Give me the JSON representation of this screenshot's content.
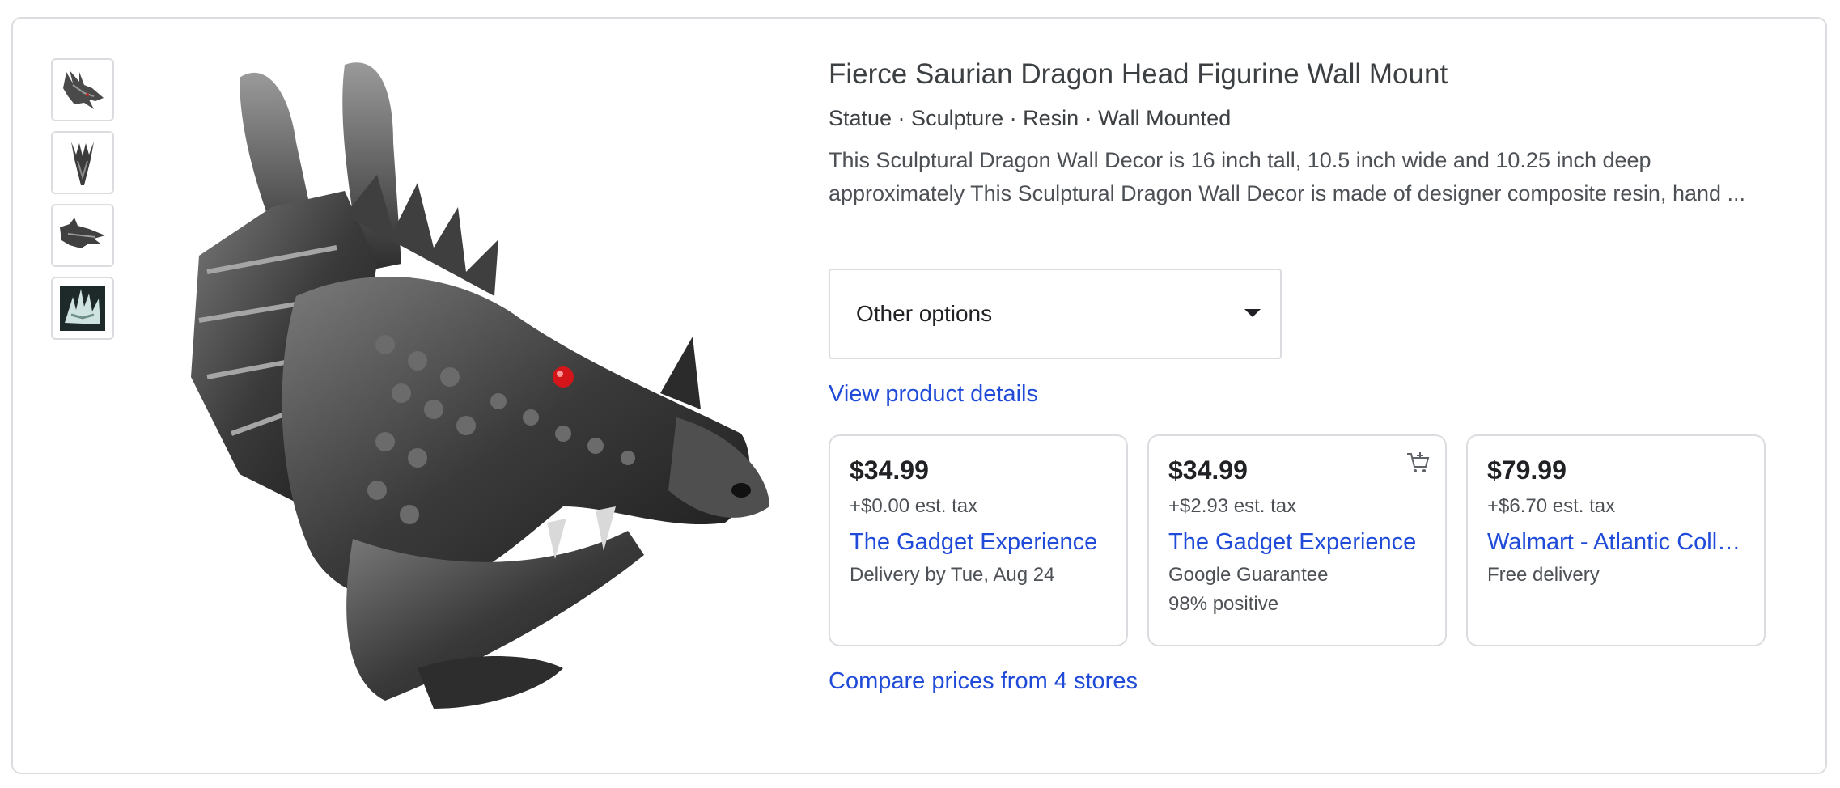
{
  "product": {
    "title": "Fierce Saurian Dragon Head Figurine Wall Mount",
    "subtitle": "Statue · Sculpture · Resin · Wall Mounted",
    "description": "This Sculptural Dragon Wall Decor is 16 inch tall, 10.5 inch wide and 10.25 inch deep approximately This Sculptural Dragon Wall Decor is made of designer composite resin, hand ...",
    "image_alt": "dragon head wall mount statue"
  },
  "thumbnails": [
    {
      "icon": "dragon-head-side-thumb"
    },
    {
      "icon": "dragon-head-front-thumb"
    },
    {
      "icon": "dragon-head-profile-thumb"
    },
    {
      "icon": "dragon-detail-thumb"
    }
  ],
  "options": {
    "label": "Other options"
  },
  "links": {
    "view_details": "View product details",
    "compare": "Compare prices from 4 stores"
  },
  "offers": [
    {
      "price": "$34.99",
      "tax": "+$0.00 est. tax",
      "merchant": "The Gadget Experience",
      "meta": [
        "Delivery by Tue, Aug 24"
      ],
      "cart": false
    },
    {
      "price": "$34.99",
      "tax": "+$2.93 est. tax",
      "merchant": "The Gadget Experience",
      "meta": [
        "Google Guarantee",
        "98% positive"
      ],
      "cart": true
    },
    {
      "price": "$79.99",
      "tax": "+$6.70 est. tax",
      "merchant": "Walmart - Atlantic Coll…",
      "meta": [
        "Free delivery"
      ],
      "cart": false
    }
  ],
  "colors": {
    "link": "#1f4bd8",
    "border": "#dadce0",
    "text": "#202124",
    "secondary": "#4d5156"
  }
}
